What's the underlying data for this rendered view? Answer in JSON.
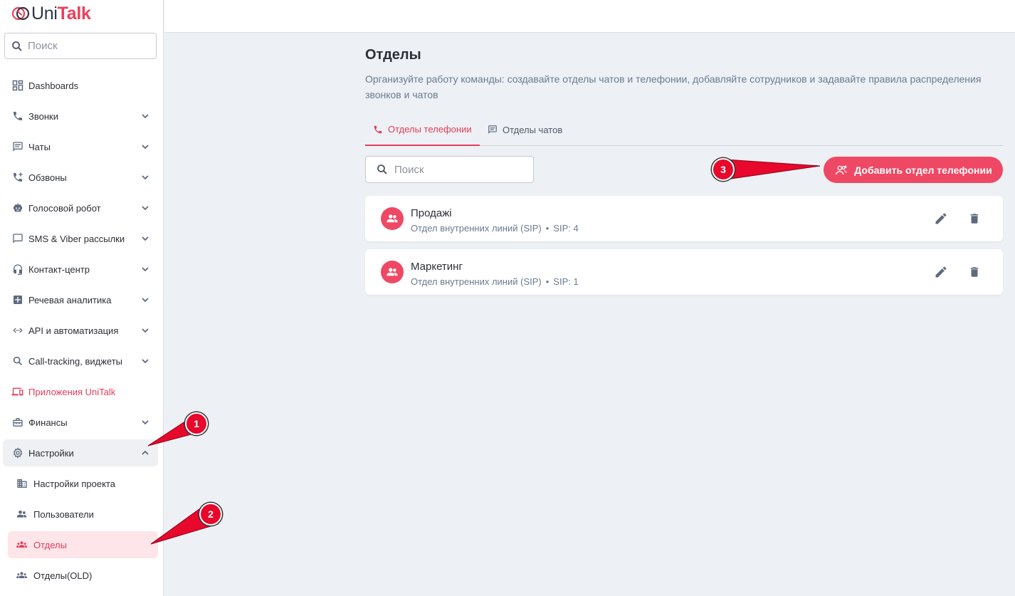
{
  "app": {
    "logo_uni": "Uni",
    "logo_talk": "Talk",
    "brand_color": "#ea3f5c"
  },
  "sidebar": {
    "search_placeholder": "Поиск",
    "items": [
      {
        "label": "Dashboards",
        "icon": "dashboard-icon"
      },
      {
        "label": "Звонки",
        "icon": "phone-icon"
      },
      {
        "label": "Чаты",
        "icon": "chat-icon"
      },
      {
        "label": "Обзвоны",
        "icon": "phone-plus-icon"
      },
      {
        "label": "Голосовой робот",
        "icon": "robot-icon"
      },
      {
        "label": "SMS & Viber рассылки",
        "icon": "message-icon"
      },
      {
        "label": "Контакт-центр",
        "icon": "headset-icon"
      },
      {
        "label": "Речевая аналитика",
        "icon": "analytics-icon"
      },
      {
        "label": "API и автоматизация",
        "icon": "api-icon"
      },
      {
        "label": "Call-tracking, виджеты",
        "icon": "search-icon"
      },
      {
        "label": "Приложения UniTalk",
        "icon": "devices-icon"
      },
      {
        "label": "Финансы",
        "icon": "wallet-icon"
      },
      {
        "label": "Настройки",
        "icon": "gear-icon"
      }
    ],
    "sub_items": [
      {
        "label": "Настройки проекта",
        "icon": "building-icon"
      },
      {
        "label": "Пользователи",
        "icon": "users-icon"
      },
      {
        "label": "Отделы",
        "icon": "groups-icon"
      },
      {
        "label": "Отделы(OLD)",
        "icon": "groups-icon"
      }
    ]
  },
  "main": {
    "title": "Отделы",
    "description": "Организуйте работу команды: создавайте отделы чатов и телефонии, добавляйте сотрудников и задавайте правила распределения звонков и чатов",
    "tabs": [
      {
        "label": "Отделы телефонии",
        "active": true
      },
      {
        "label": "Отделы чатов",
        "active": false
      }
    ],
    "search_placeholder": "Поиск",
    "add_button_label": "Добавить отдел телефонии",
    "departments": [
      {
        "name": "Продажі",
        "type": "Отдел внутренних линий (SIP)",
        "separator": "•",
        "sip": "SIP: 4"
      },
      {
        "name": "Маркетинг",
        "type": "Отдел внутренних линий (SIP)",
        "separator": "•",
        "sip": "SIP: 1"
      }
    ]
  },
  "annotations": [
    "1",
    "2",
    "3"
  ]
}
